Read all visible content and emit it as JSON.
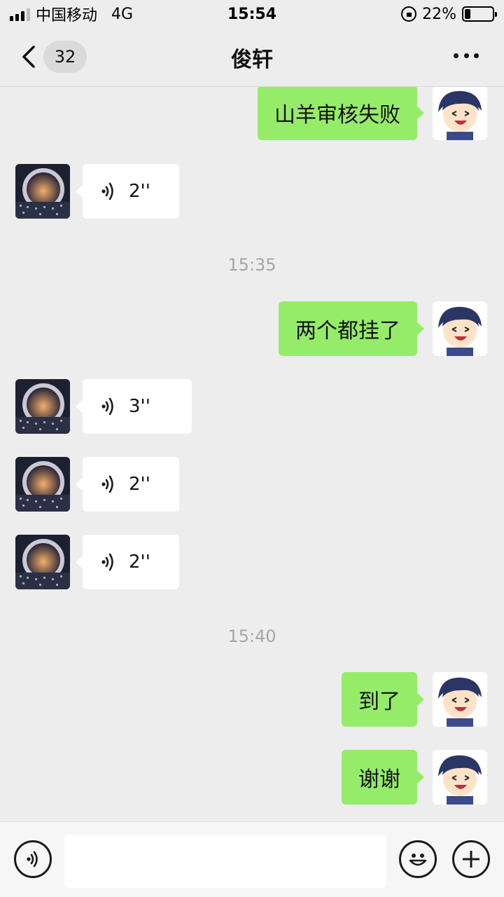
{
  "status_bar": {
    "carrier": "中国移动",
    "network": "4G",
    "time": "15:54",
    "battery_percent": "22%",
    "battery_level": 0.22
  },
  "header": {
    "unread_count": "32",
    "title": "俊轩"
  },
  "messages": [
    {
      "sender": "me",
      "type": "text",
      "text": "山羊审核失败"
    },
    {
      "sender": "other",
      "type": "voice",
      "duration": "2''"
    },
    {
      "type": "timestamp",
      "text": "15:35"
    },
    {
      "sender": "me",
      "type": "text",
      "text": "两个都挂了"
    },
    {
      "sender": "other",
      "type": "voice",
      "duration": "3''"
    },
    {
      "sender": "other",
      "type": "voice",
      "duration": "2''"
    },
    {
      "sender": "other",
      "type": "voice",
      "duration": "2''"
    },
    {
      "type": "timestamp",
      "text": "15:40"
    },
    {
      "sender": "me",
      "type": "text",
      "text": "到了"
    },
    {
      "sender": "me",
      "type": "text",
      "text": "谢谢"
    }
  ],
  "input": {
    "value": "",
    "placeholder": ""
  },
  "icons": {
    "back": "chevron-left-icon",
    "more": "more-dots-icon",
    "voice_toggle": "voice-icon",
    "emoji": "emoji-icon",
    "add": "plus-icon"
  },
  "colors": {
    "my_bubble": "#95ec69",
    "other_bubble": "#ffffff",
    "background": "#ededed"
  }
}
